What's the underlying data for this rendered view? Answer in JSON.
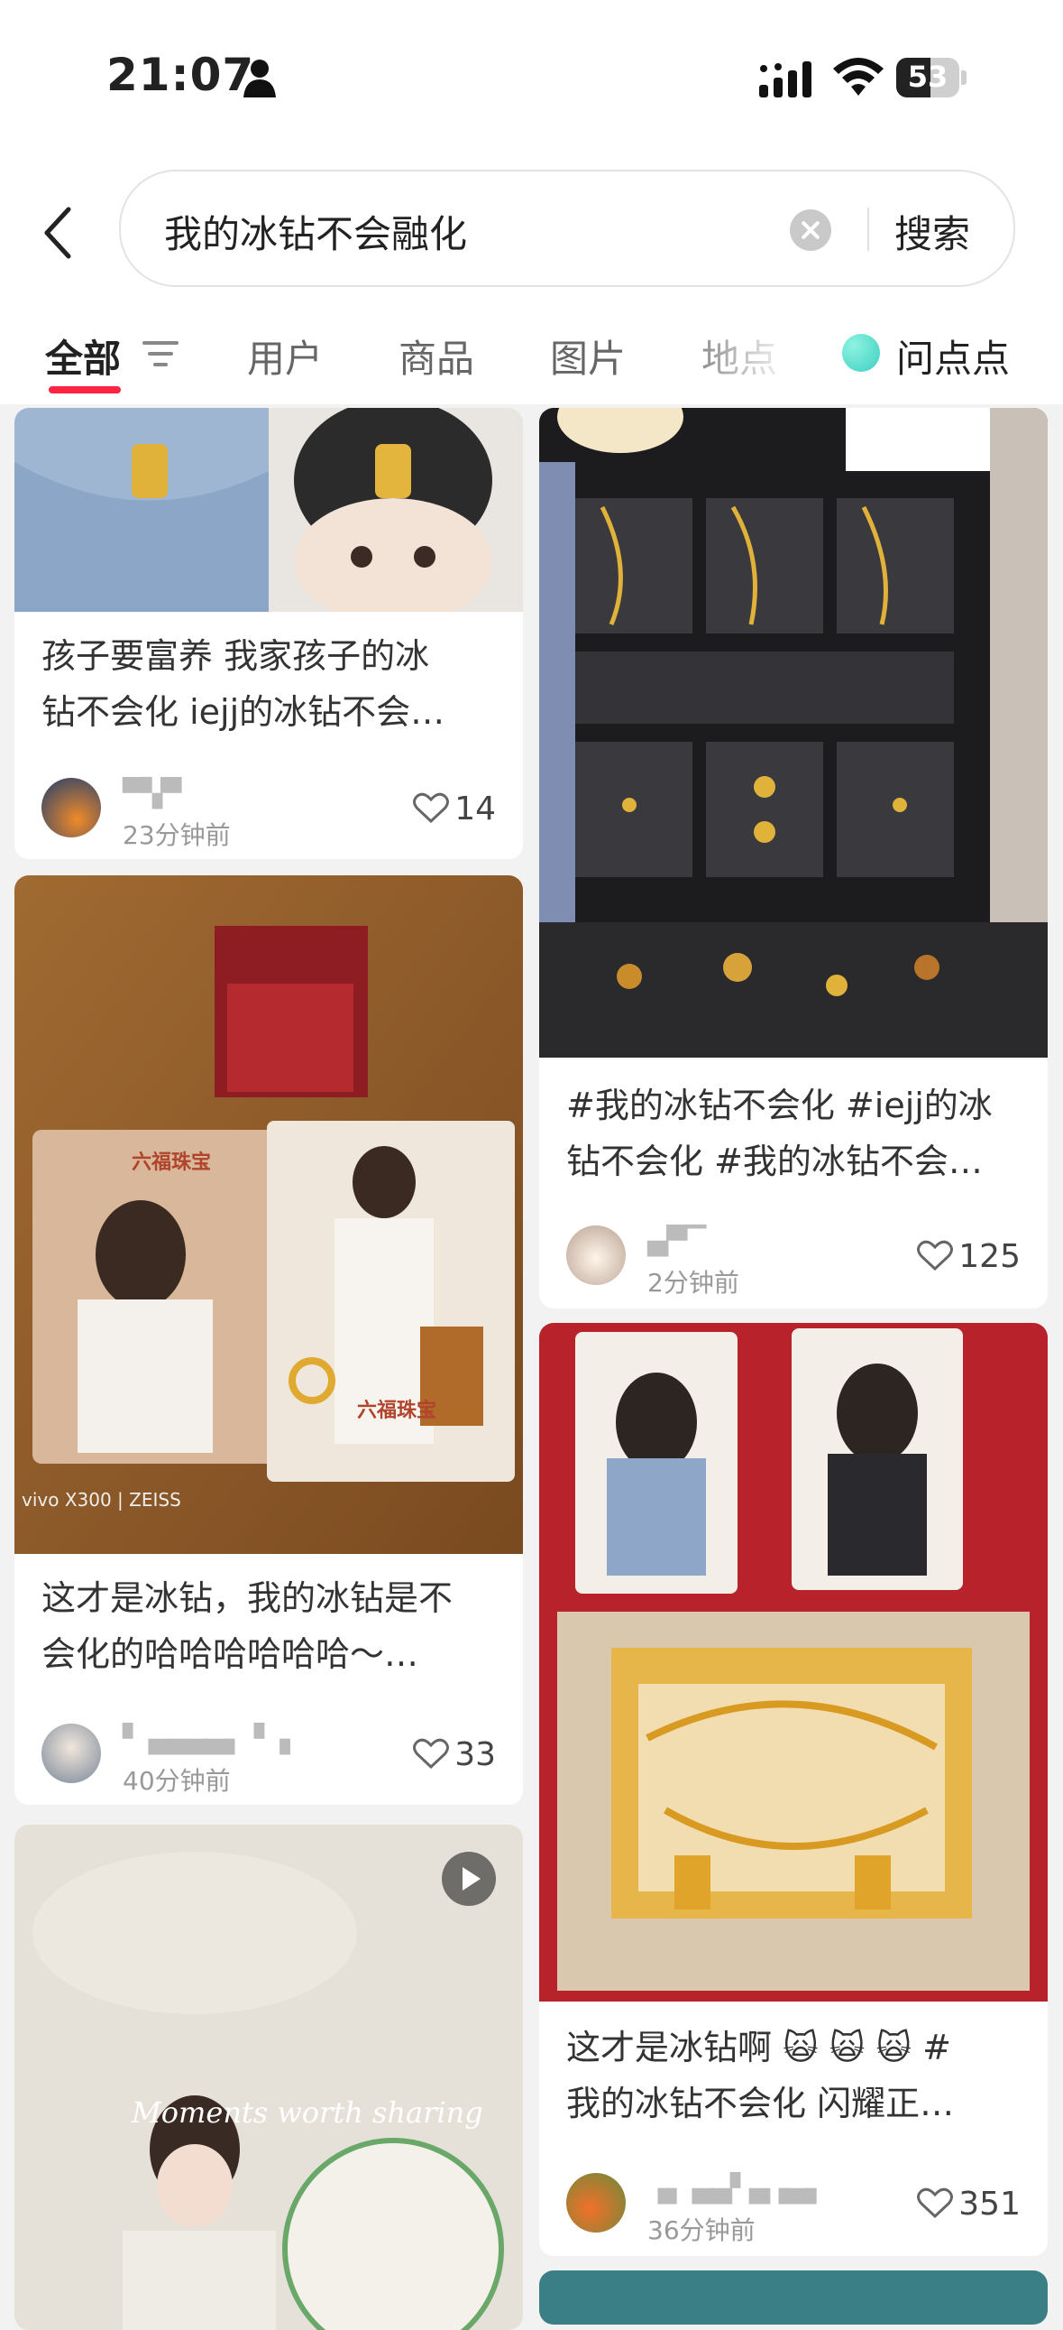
{
  "status_bar": {
    "time": "21:07",
    "battery": "53"
  },
  "search": {
    "query": "我的冰钻不会融化",
    "button": "搜索"
  },
  "tabs": [
    "全部",
    "用户",
    "商品",
    "图片",
    "地点",
    "问点点"
  ],
  "cards": [
    {
      "title_line1": "孩子要富养 我家孩子的冰",
      "title_line2": "钻不会化 iejj的冰钻不会…",
      "username": "▀▚▀",
      "time": "23分钟前",
      "likes": "14"
    },
    {
      "title_line1": "这才是冰钻，我的冰钻是不",
      "title_line2": "会化的哈哈哈哈哈哈～…",
      "username": "▘ ▄▄▄▄▖▝ ▗",
      "time": "40分钟前",
      "likes": "33"
    },
    {
      "title_line1": "#我的冰钻不会化 #iejj的冰",
      "title_line2": "钻不会化 #我的冰钻不会…",
      "username": "▄▀▔",
      "time": "2分钟前",
      "likes": "125"
    },
    {
      "title_line1": "这才是冰钻啊 🙀 🙀 🙀 #",
      "title_line2": "我的冰钻不会化 闪耀正…",
      "username": "▗▖ ▄▄▘▄▗▄▖",
      "time": "36分钟前",
      "likes": "351"
    }
  ],
  "overlay_text": {
    "moments": "Moments worth sharing",
    "brand": "六福珠宝",
    "watermark": "vivo X300 | ZEISS"
  }
}
